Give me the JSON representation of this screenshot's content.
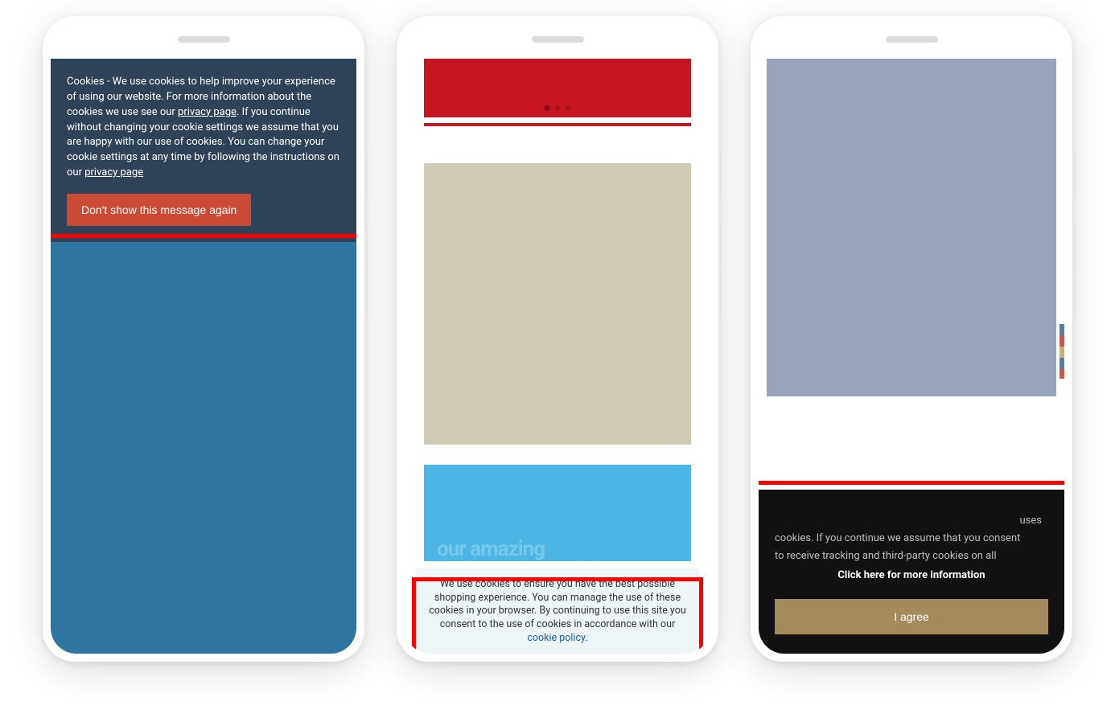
{
  "phones": [
    {
      "cookie_text_prefix": "Cookies - We use cookies to help improve your experience of using our website. For more information about the cookies we use see our ",
      "privacy_link_1": "privacy page",
      "cookie_text_middle": ". If you continue without changing your cookie settings we assume that you are happy with our use of cookies. You can change your cookie settings at any time by following the instructions on our ",
      "privacy_link_2": "privacy page",
      "dismiss_button": "Don't show this message again"
    },
    {
      "faded_background_text": "our amazing",
      "cookie_text_prefix": "We use cookies to ensure you have the best possible shopping experience. You can manage the use of these cookies in your browser. By continuing to use this site you consent to the use of cookies in accordance with our ",
      "policy_link": "cookie policy",
      "period": "."
    },
    {
      "cookie_text_line1_suffix": " uses",
      "cookie_text_line2": "cookies. If you continue we assume that you consent",
      "cookie_text_line3": "to receive tracking and third-party cookies on all",
      "info_link": "Click here for more information",
      "agree_button": "I agree"
    }
  ]
}
